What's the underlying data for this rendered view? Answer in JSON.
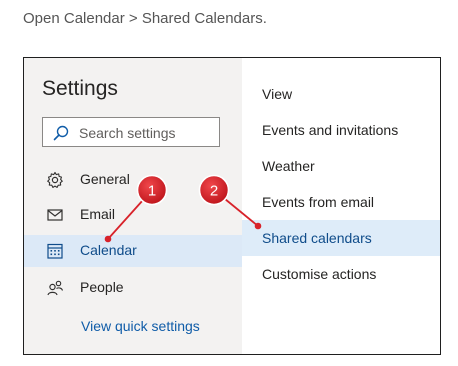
{
  "caption": "Open Calendar > Shared Calendars.",
  "settings": {
    "title": "Settings",
    "search_placeholder": "Search settings",
    "nav": [
      {
        "label": "General",
        "icon": "gear-icon"
      },
      {
        "label": "Email",
        "icon": "mail-icon"
      },
      {
        "label": "Calendar",
        "icon": "calendar-icon",
        "selected": true
      },
      {
        "label": "People",
        "icon": "people-icon"
      }
    ],
    "quick_settings_link": "View quick settings"
  },
  "calendar_options": [
    {
      "label": "View"
    },
    {
      "label": "Events and invitations"
    },
    {
      "label": "Weather"
    },
    {
      "label": "Events from email"
    },
    {
      "label": "Shared calendars",
      "selected": true
    },
    {
      "label": "Customise actions"
    }
  ],
  "callouts": [
    {
      "number": "1",
      "target": "Calendar"
    },
    {
      "number": "2",
      "target": "Shared calendars"
    }
  ],
  "colors": {
    "accent": "#0f4c8a",
    "selection": "#dce9f7",
    "callout": "#d8222a"
  }
}
